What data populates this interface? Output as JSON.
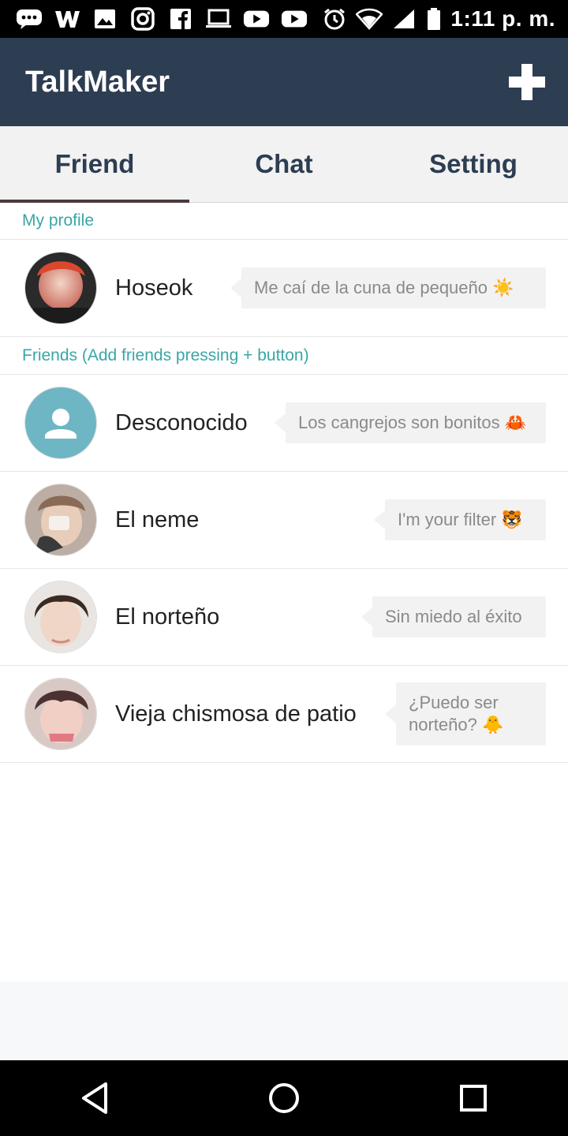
{
  "status_bar": {
    "time": "1:11 p. m.",
    "icons": [
      "chat-icon",
      "w-icon",
      "image-icon",
      "instagram-icon",
      "facebook-icon",
      "laptop-icon",
      "youtube-icon",
      "youtube-icon",
      "alarm-icon",
      "wifi-icon",
      "signal-icon",
      "battery-icon"
    ]
  },
  "app_bar": {
    "title": "TalkMaker",
    "add_icon": "plus-icon"
  },
  "tabs": [
    {
      "label": "Friend",
      "active": true
    },
    {
      "label": "Chat",
      "active": false
    },
    {
      "label": "Setting",
      "active": false
    }
  ],
  "profile_section": {
    "header": "My profile"
  },
  "profile": {
    "name": "Hoseok",
    "status": "Me caí de la cuna de pequeño ☀️"
  },
  "friends_section": {
    "header": "Friends (Add friends pressing + button)"
  },
  "friends": [
    {
      "name": "Desconocido",
      "status": "Los cangrejos son bonitos 🦀",
      "avatar": "default-avatar-icon"
    },
    {
      "name": "El neme",
      "status": "I'm your filter 🐯",
      "avatar": "photo"
    },
    {
      "name": "El norteño",
      "status": "Sin miedo al éxito",
      "avatar": "photo"
    },
    {
      "name": "Vieja chismosa de patio",
      "status": "¿Puedo ser norteño? 🐥",
      "avatar": "photo"
    }
  ],
  "nav_bar": {
    "icons": [
      "back-icon",
      "home-icon",
      "recents-icon"
    ]
  },
  "colors": {
    "app_bar": "#2d3d52",
    "accent": "#3aa6a6",
    "tab_bg": "#f2f2f2",
    "bubble_bg": "#f2f2f2"
  }
}
